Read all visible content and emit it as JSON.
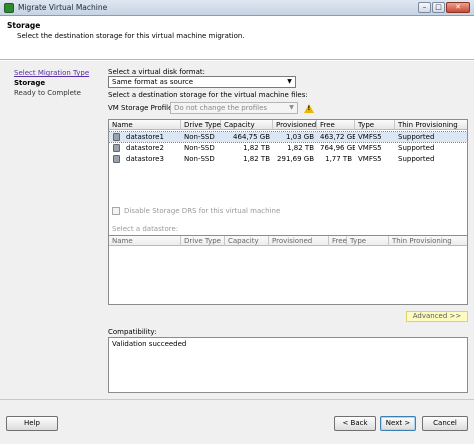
{
  "window": {
    "title": "Migrate Virtual Machine",
    "minimize": "–",
    "maximize": "□",
    "close": "✕"
  },
  "header": {
    "title": "Storage",
    "subtitle": "Select the destination storage for this virtual machine migration."
  },
  "nav": {
    "items": [
      "Select Migration Type",
      "Storage",
      "Ready to Complete"
    ]
  },
  "form": {
    "disk_format_label": "Select a virtual disk format:",
    "disk_format_value": "Same format as source",
    "dest_storage_label": "Select a destination storage for the virtual machine files:",
    "vm_profile_label": "VM Storage Profile:",
    "vm_profile_value": "Do not change the profiles"
  },
  "datastores": {
    "columns": [
      "Name",
      "Drive Type",
      "Capacity",
      "Provisioned",
      "Free",
      "Type",
      "Thin Provisioning"
    ],
    "rows": [
      [
        "datastore1",
        "Non-SSD",
        "464,75 GB",
        "1,03 GB",
        "463,72 GB",
        "VMFS5",
        "Supported"
      ],
      [
        "datastore2",
        "Non-SSD",
        "1,82 TB",
        "1,82 TB",
        "764,96 GB",
        "VMFS5",
        "Supported"
      ],
      [
        "datastore3",
        "Non-SSD",
        "1,82 TB",
        "291,69 GB",
        "1,77 TB",
        "VMFS5",
        "Supported"
      ]
    ]
  },
  "drs": {
    "label": "Disable Storage DRS for this virtual machine"
  },
  "select_datastore": {
    "label": "Select a datastore:",
    "columns": [
      "Name",
      "Drive Type",
      "Capacity",
      "Provisioned",
      "Free",
      "Type",
      "Thin Provisioning"
    ]
  },
  "advanced_button": "Advanced >>",
  "compatibility": {
    "label": "Compatibility:",
    "value": "Validation succeeded"
  },
  "footer": {
    "help": "Help",
    "back": "< Back",
    "next": "Next >",
    "cancel": "Cancel"
  }
}
